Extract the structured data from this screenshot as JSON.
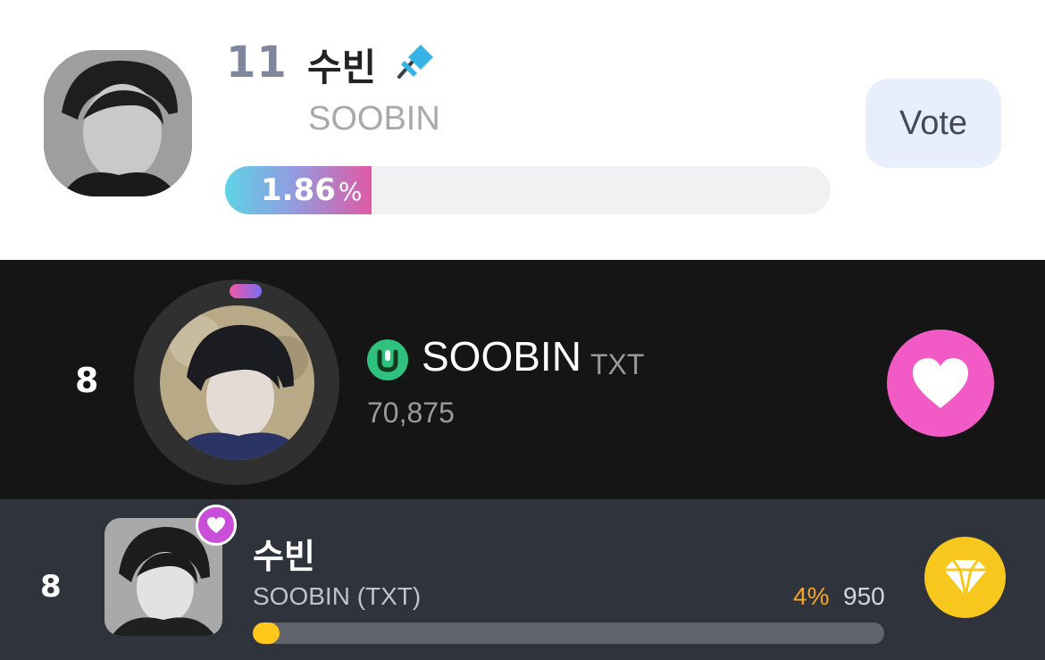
{
  "entry_1": {
    "rank": "11",
    "name_korean": "수빈",
    "name_english": "SOOBIN",
    "percent_value": "1.86",
    "percent_sign": "%",
    "percent_fill_fraction": 0.0186,
    "vote_button_label": "Vote",
    "icons": {
      "pin": "pushpin-icon",
      "avatar": "avatar-photo"
    },
    "colors": {
      "rank": "#7e879c",
      "bar_start": "#5fd3e6",
      "bar_end": "#e05aa6",
      "vote_bg": "#e8eefc"
    }
  },
  "entry_2": {
    "rank": "8",
    "name": "SOOBIN",
    "group": "TXT",
    "count": "70,875",
    "icons": {
      "badge": "app-badge-icon",
      "heart": "heart-icon"
    },
    "colors": {
      "background": "#151515",
      "badge": "#2ec27e",
      "heart_button": "#f25ac6"
    }
  },
  "entry_3": {
    "rank": "8",
    "name_korean": "수빈",
    "name_english": "SOOBIN (TXT)",
    "percent": "4%",
    "votes": "950",
    "percent_fill_fraction": 0.04,
    "icons": {
      "favorite_badge": "heart-badge-icon",
      "diamond": "diamond-icon"
    },
    "colors": {
      "background": "#2e333c",
      "percent": "#f6a623",
      "bar_fill": "#ffc719",
      "diamond_button": "#f7c71d"
    }
  }
}
